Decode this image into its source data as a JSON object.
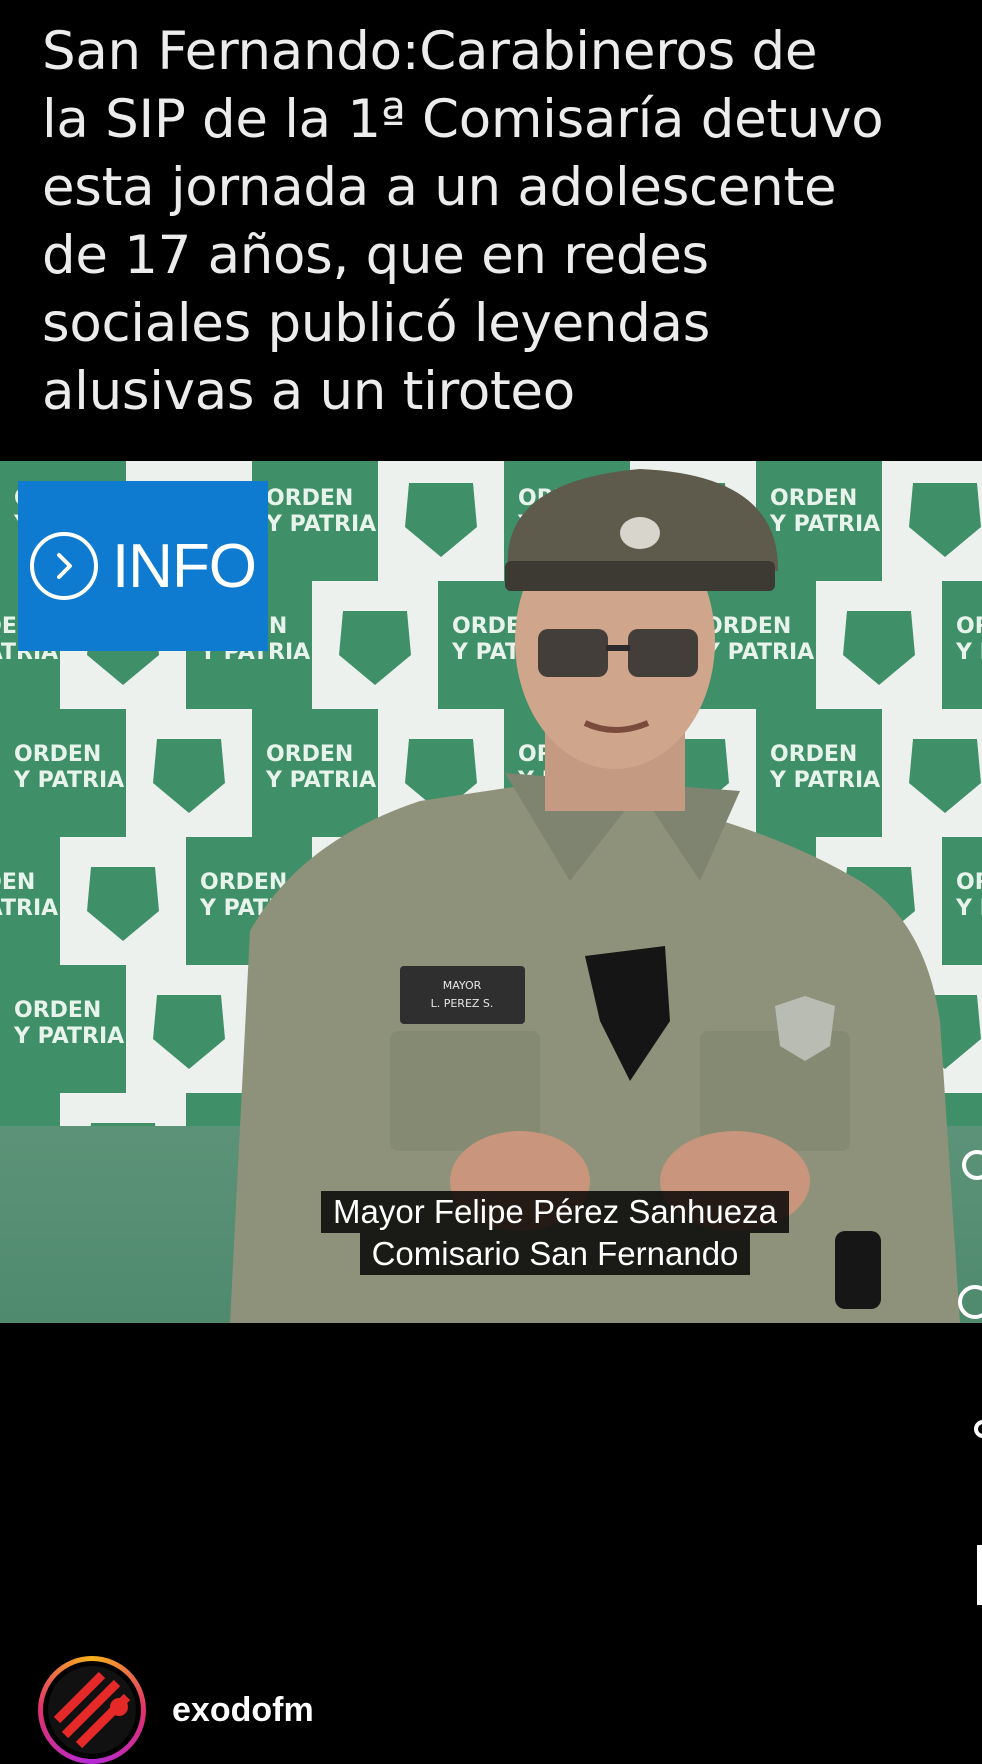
{
  "post": {
    "headline_lines": [
      "San Fernando:Carabineros de",
      "la SIP de la 1ª Comisaría detuvo",
      "esta jornada a un adolescente",
      "de 17 años, que en redes",
      "sociales publicó leyendas",
      "alusivas a un tiroteo"
    ]
  },
  "video": {
    "badge_label": "INFO",
    "backdrop_text": "ORDEN Y PATRIA",
    "caption_lines": [
      "Mayor Felipe Pérez Sanhueza",
      "Comisario San Fernando"
    ],
    "name_tag": "MAYOR L. PEREZ S."
  },
  "account": {
    "username": "exodofm"
  },
  "colors": {
    "background": "#000000",
    "info_badge": "#0f7bd0",
    "backdrop_green": "#3f8f68",
    "uniform": "#8f927a"
  },
  "icons": [
    "chevron-right-icon",
    "avatar-logo-icon"
  ]
}
